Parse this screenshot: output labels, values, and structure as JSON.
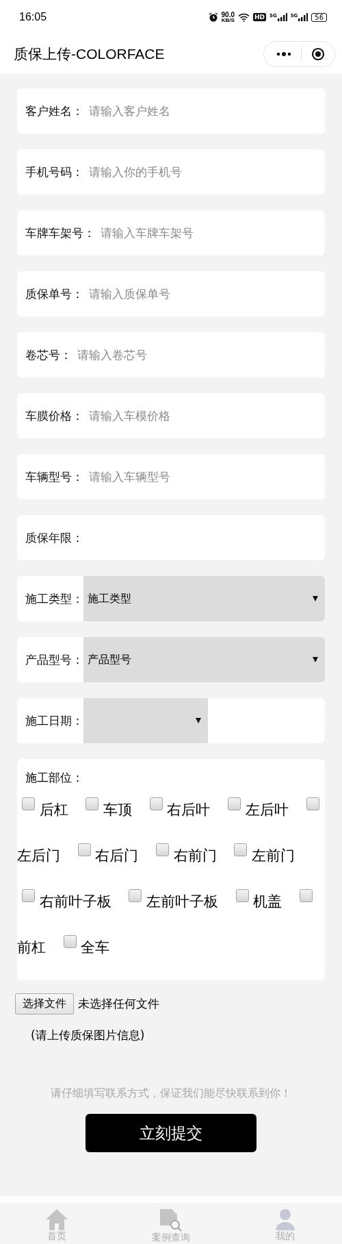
{
  "status_bar": {
    "time": "16:05",
    "speed": "90.0",
    "speed_unit": "KB/S",
    "hd": "HD",
    "sim_1": "5G",
    "sim_2": "5G",
    "battery": "56"
  },
  "title_bar": {
    "title": "质保上传-COLORFACE"
  },
  "form": {
    "fields": [
      {
        "kind": "text",
        "label": "客户姓名：",
        "placeholder": "请输入客户姓名"
      },
      {
        "kind": "text",
        "label": "手机号码：",
        "placeholder": "请输入你的手机号"
      },
      {
        "kind": "text",
        "label": "车牌车架号：",
        "placeholder": "请输入车牌车架号"
      },
      {
        "kind": "text",
        "label": "质保单号：",
        "placeholder": "请输入质保单号"
      },
      {
        "kind": "text",
        "label": "卷芯号：",
        "placeholder": "请输入卷芯号"
      },
      {
        "kind": "text",
        "label": "车膜价格：",
        "placeholder": "请输入车模价格"
      },
      {
        "kind": "text",
        "label": "车辆型号：",
        "placeholder": "请输入车辆型号"
      },
      {
        "kind": "label",
        "label": "质保年限："
      },
      {
        "kind": "select",
        "label": "施工类型：",
        "value": "施工类型"
      },
      {
        "kind": "select",
        "label": "产品型号：",
        "value": "产品型号"
      },
      {
        "kind": "date",
        "label": "施工日期："
      }
    ],
    "parts": {
      "label": "施工部位：",
      "options": [
        {
          "label": "后杠",
          "checked": false
        },
        {
          "label": "车顶",
          "checked": false
        },
        {
          "label": "右后叶",
          "checked": false
        },
        {
          "label": "左后叶",
          "checked": false
        },
        {
          "label": "左后门",
          "checked": false
        },
        {
          "label": "右后门",
          "checked": false
        },
        {
          "label": "右前门",
          "checked": false
        },
        {
          "label": "左前门",
          "checked": false
        },
        {
          "label": "右前叶子板",
          "checked": false
        },
        {
          "label": "左前叶子板",
          "checked": false
        },
        {
          "label": "机盖",
          "checked": false
        },
        {
          "label": "前杠",
          "checked": false
        },
        {
          "label": "全车",
          "checked": false
        }
      ]
    },
    "upload": {
      "button": "选择文件",
      "status": "未选择任何文件",
      "note": "(请上传质保图片信息)"
    },
    "hint": "请仔细填写联系方式，保证我们能尽快联系到你！",
    "submit": "立刻提交"
  },
  "tab_bar": [
    {
      "label": "首页"
    },
    {
      "label": "案例查询"
    },
    {
      "label": "我的"
    }
  ]
}
